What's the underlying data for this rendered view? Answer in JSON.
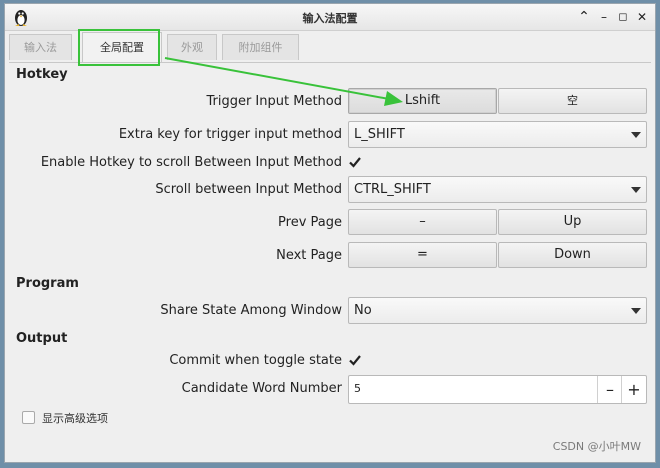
{
  "window": {
    "title": "输入法配置",
    "controls": {
      "minimize": "–",
      "restore": "▴",
      "maximize": "☐",
      "close": "✕"
    }
  },
  "tabs": [
    {
      "label": "输入法",
      "active": false
    },
    {
      "label": "全局配置",
      "active": true
    },
    {
      "label": "外观",
      "active": false
    },
    {
      "label": "附加组件",
      "active": false
    }
  ],
  "hotkey": {
    "heading": "Hotkey",
    "trigger": {
      "label": "Trigger Input Method",
      "primary": "Lshift",
      "secondary": "空"
    },
    "extra_key": {
      "label": "Extra key for trigger input method",
      "value": "L_SHIFT"
    },
    "enable_scroll": {
      "label": "Enable Hotkey to scroll Between Input Method",
      "checked": true
    },
    "scroll_between": {
      "label": "Scroll between Input Method",
      "value": "CTRL_SHIFT"
    },
    "prev_page": {
      "label": "Prev Page",
      "primary": "–",
      "secondary": "Up"
    },
    "next_page": {
      "label": "Next Page",
      "primary": "=",
      "secondary": "Down"
    }
  },
  "program": {
    "heading": "Program",
    "share_state": {
      "label": "Share State Among Window",
      "value": "No"
    }
  },
  "output": {
    "heading": "Output",
    "commit_toggle": {
      "label": "Commit when toggle state",
      "checked": true
    },
    "candidate_number": {
      "label": "Candidate Word Number",
      "value": "5",
      "minus": "–",
      "plus": "+"
    }
  },
  "advanced": {
    "label": "显示高级选项",
    "checked": false
  },
  "watermark": "CSDN @小叶MW",
  "colors": {
    "annotation": "#39c23a",
    "window_bg": "#efefef",
    "desktop_bg": "#6f8fa8"
  }
}
